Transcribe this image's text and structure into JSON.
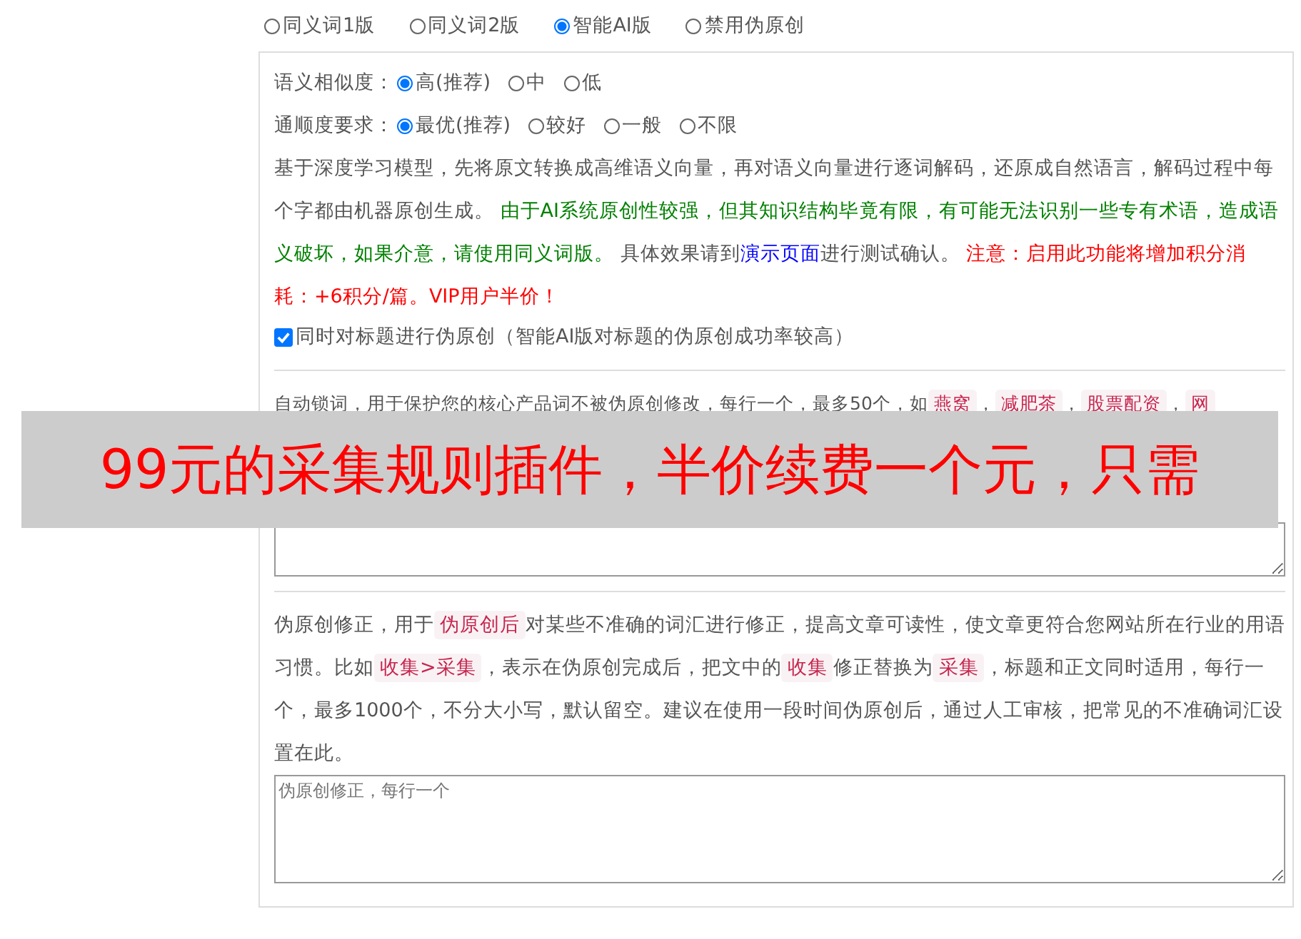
{
  "modes": [
    {
      "label": "同义词1版",
      "selected": false
    },
    {
      "label": "同义词2版",
      "selected": false
    },
    {
      "label": "智能AI版",
      "selected": true
    },
    {
      "label": "禁用伪原创",
      "selected": false
    }
  ],
  "similarity": {
    "label": "语义相似度：",
    "options": [
      {
        "label": "高(推荐)",
        "selected": true
      },
      {
        "label": "中",
        "selected": false
      },
      {
        "label": "低",
        "selected": false
      }
    ]
  },
  "fluency": {
    "label": "通顺度要求：",
    "options": [
      {
        "label": "最优(推荐)",
        "selected": true
      },
      {
        "label": "较好",
        "selected": false
      },
      {
        "label": "一般",
        "selected": false
      },
      {
        "label": "不限",
        "selected": false
      }
    ]
  },
  "description": [
    {
      "kind": "plain",
      "text": "基于深度学习模型，先将原文转换成高维语义向量，再对语义向量进行逐词解码，还原成自然语言，解码过程中每个字都由机器原创生成。 "
    },
    {
      "kind": "green",
      "text": "由于AI系统原创性较强，但其知识结构毕竟有限，有可能无法识别一些专有术语，造成语义破坏，如果介意，请使用同义词版。"
    },
    {
      "kind": "plain",
      "text": " 具体效果请到"
    },
    {
      "kind": "link",
      "text": "演示页面"
    },
    {
      "kind": "plain",
      "text": "进行测试确认。 "
    },
    {
      "kind": "red",
      "text": "注意：启用此功能将增加积分消耗：+6积分/篇。VIP用户半价！"
    }
  ],
  "title_option": {
    "label": "同时对标题进行伪原创（智能AI版对标题的伪原创成功率较高）",
    "checked": true
  },
  "lock_words": {
    "segments": [
      {
        "kind": "plain",
        "text": "自动锁词，用于保护您的核心产品词不被伪原创修改，每行一个，最多50个，如"
      },
      {
        "kind": "code",
        "text": "燕窝"
      },
      {
        "kind": "plain",
        "text": "，"
      },
      {
        "kind": "code",
        "text": "减肥茶"
      },
      {
        "kind": "plain",
        "text": "，"
      },
      {
        "kind": "code",
        "text": "股票配资"
      },
      {
        "kind": "plain",
        "text": "，"
      },
      {
        "kind": "code",
        "text": "网"
      }
    ]
  },
  "correction": {
    "segments": [
      {
        "kind": "plain",
        "text": "伪原创修正，用于"
      },
      {
        "kind": "code",
        "text": "伪原创后"
      },
      {
        "kind": "plain",
        "text": "对某些不准确的词汇进行修正，提高文章可读性，使文章更符合您网站所在行业的用语习惯。比如"
      },
      {
        "kind": "code",
        "text": "收集>采集"
      },
      {
        "kind": "plain",
        "text": "，表示在伪原创完成后，把文中的"
      },
      {
        "kind": "code",
        "text": "收集"
      },
      {
        "kind": "plain",
        "text": "修正替换为"
      },
      {
        "kind": "code",
        "text": "采集"
      },
      {
        "kind": "plain",
        "text": "，标题和正文同时适用，每行一个，最多1000个，不分大小写，默认留空。建议在使用一段时间伪原创后，通过人工审核，把常见的不准确词汇设置在此。"
      }
    ],
    "placeholder": "伪原创修正，每行一个"
  },
  "banner": {
    "text": "99元的采集规则插件，半价续费一个元，只需"
  }
}
